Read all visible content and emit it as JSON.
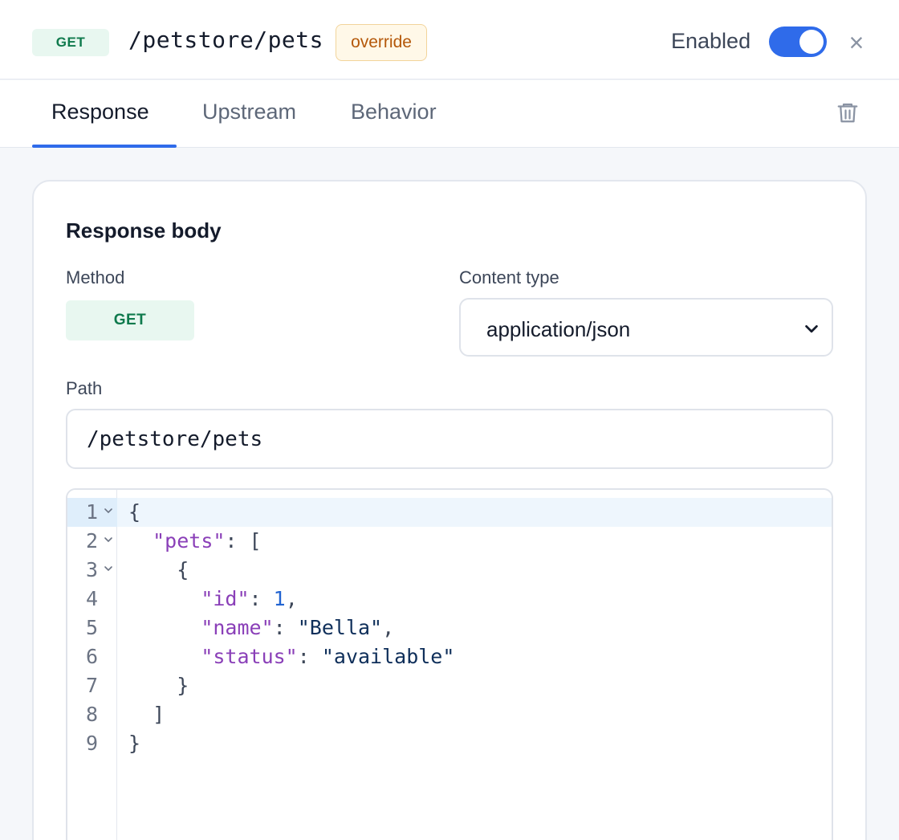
{
  "header": {
    "method": "GET",
    "route": "/petstore/pets",
    "badge": "override",
    "enabled_label": "Enabled",
    "enabled": true,
    "close_icon": "close-icon"
  },
  "tabs": [
    {
      "label": "Response",
      "active": true
    },
    {
      "label": "Upstream",
      "active": false
    },
    {
      "label": "Behavior",
      "active": false
    }
  ],
  "trash_icon": "trash-icon",
  "form": {
    "section_title": "Response body",
    "method_label": "Method",
    "method_value": "GET",
    "content_type_label": "Content type",
    "content_type_value": "application/json",
    "path_label": "Path",
    "path_value": "/petstore/pets"
  },
  "editor": {
    "active_line": 1,
    "lines": [
      {
        "n": "1",
        "fold": true,
        "indent": "",
        "tokens": [
          {
            "t": "p",
            "v": "{"
          }
        ]
      },
      {
        "n": "2",
        "fold": true,
        "indent": "  ",
        "tokens": [
          {
            "t": "k",
            "v": "\"pets\""
          },
          {
            "t": "p",
            "v": ": ["
          }
        ]
      },
      {
        "n": "3",
        "fold": true,
        "indent": "    ",
        "tokens": [
          {
            "t": "p",
            "v": "{"
          }
        ]
      },
      {
        "n": "4",
        "fold": false,
        "indent": "      ",
        "tokens": [
          {
            "t": "k",
            "v": "\"id\""
          },
          {
            "t": "p",
            "v": ": "
          },
          {
            "t": "n",
            "v": "1"
          },
          {
            "t": "p",
            "v": ","
          }
        ]
      },
      {
        "n": "5",
        "fold": false,
        "indent": "      ",
        "tokens": [
          {
            "t": "k",
            "v": "\"name\""
          },
          {
            "t": "p",
            "v": ": "
          },
          {
            "t": "s",
            "v": "\"Bella\""
          },
          {
            "t": "p",
            "v": ","
          }
        ]
      },
      {
        "n": "6",
        "fold": false,
        "indent": "      ",
        "tokens": [
          {
            "t": "k",
            "v": "\"status\""
          },
          {
            "t": "p",
            "v": ": "
          },
          {
            "t": "s",
            "v": "\"available\""
          }
        ]
      },
      {
        "n": "7",
        "fold": false,
        "indent": "    ",
        "tokens": [
          {
            "t": "p",
            "v": "}"
          }
        ]
      },
      {
        "n": "8",
        "fold": false,
        "indent": "  ",
        "tokens": [
          {
            "t": "p",
            "v": "]"
          }
        ]
      },
      {
        "n": "9",
        "fold": false,
        "indent": "",
        "tokens": [
          {
            "t": "p",
            "v": "}"
          }
        ]
      }
    ]
  },
  "colors": {
    "accent": "#2f6bea",
    "get_bg": "#e8f7f0",
    "get_text": "#0f7a4d",
    "override_bg": "#fff8e8",
    "override_text": "#b4580a",
    "json_key": "#8a3fb8",
    "json_string": "#0f2f5a",
    "json_number": "#2264d1"
  }
}
